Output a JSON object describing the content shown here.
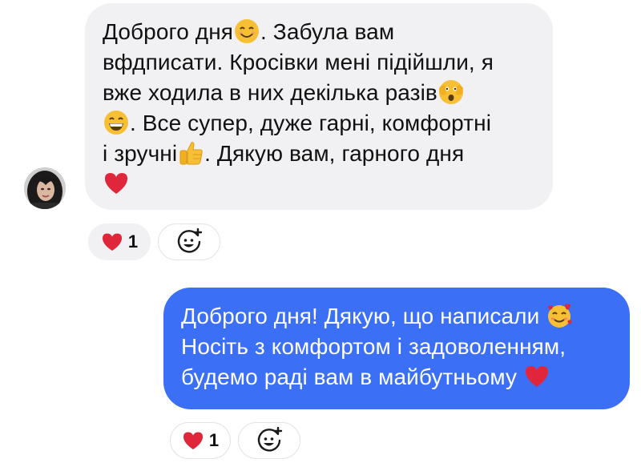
{
  "incoming": {
    "lines": [
      {
        "before": "Доброго дня",
        "emoji": "smile-emoji",
        "after": ". Забула вам"
      },
      {
        "before": "вфдписати. Кросівки мені підійшли, я",
        "emoji": "",
        "after": ""
      },
      {
        "before": "вже ходила в них декілька разів",
        "emoji": "peek-emoji",
        "after": ""
      },
      {
        "before": "",
        "emoji": "grin-emoji",
        "after": ". Все супер, дуже гарні, комфортні"
      },
      {
        "before": "і зручні",
        "emoji": "thumbs-up-emoji",
        "after": ". Дякую вам, гарного дня"
      },
      {
        "before": "",
        "emoji": "heart-emoji",
        "after": ""
      }
    ],
    "reaction": {
      "emoji": "heart-emoji",
      "count": "1"
    },
    "add_reaction_icon": "add-reaction-icon"
  },
  "outgoing": {
    "lines": [
      {
        "before": "Доброго дня! Дякую, що написали ",
        "emoji": "smiling-face-with-hearts-emoji",
        "after": ""
      },
      {
        "before": "Носіть з комфортом і задоволенням,",
        "emoji": "",
        "after": ""
      },
      {
        "before": "будемо раді вам в майбутньому ",
        "emoji": "heart-emoji",
        "after": ""
      }
    ],
    "reaction": {
      "emoji": "heart-emoji",
      "count": "1"
    },
    "add_reaction_icon": "add-reaction-icon"
  },
  "colors": {
    "incoming_bubble": "#f1f1f3",
    "outgoing_bubble": "#3b6ff5",
    "heart": "#e0263a",
    "emoji_yellow": "#f7c034"
  }
}
